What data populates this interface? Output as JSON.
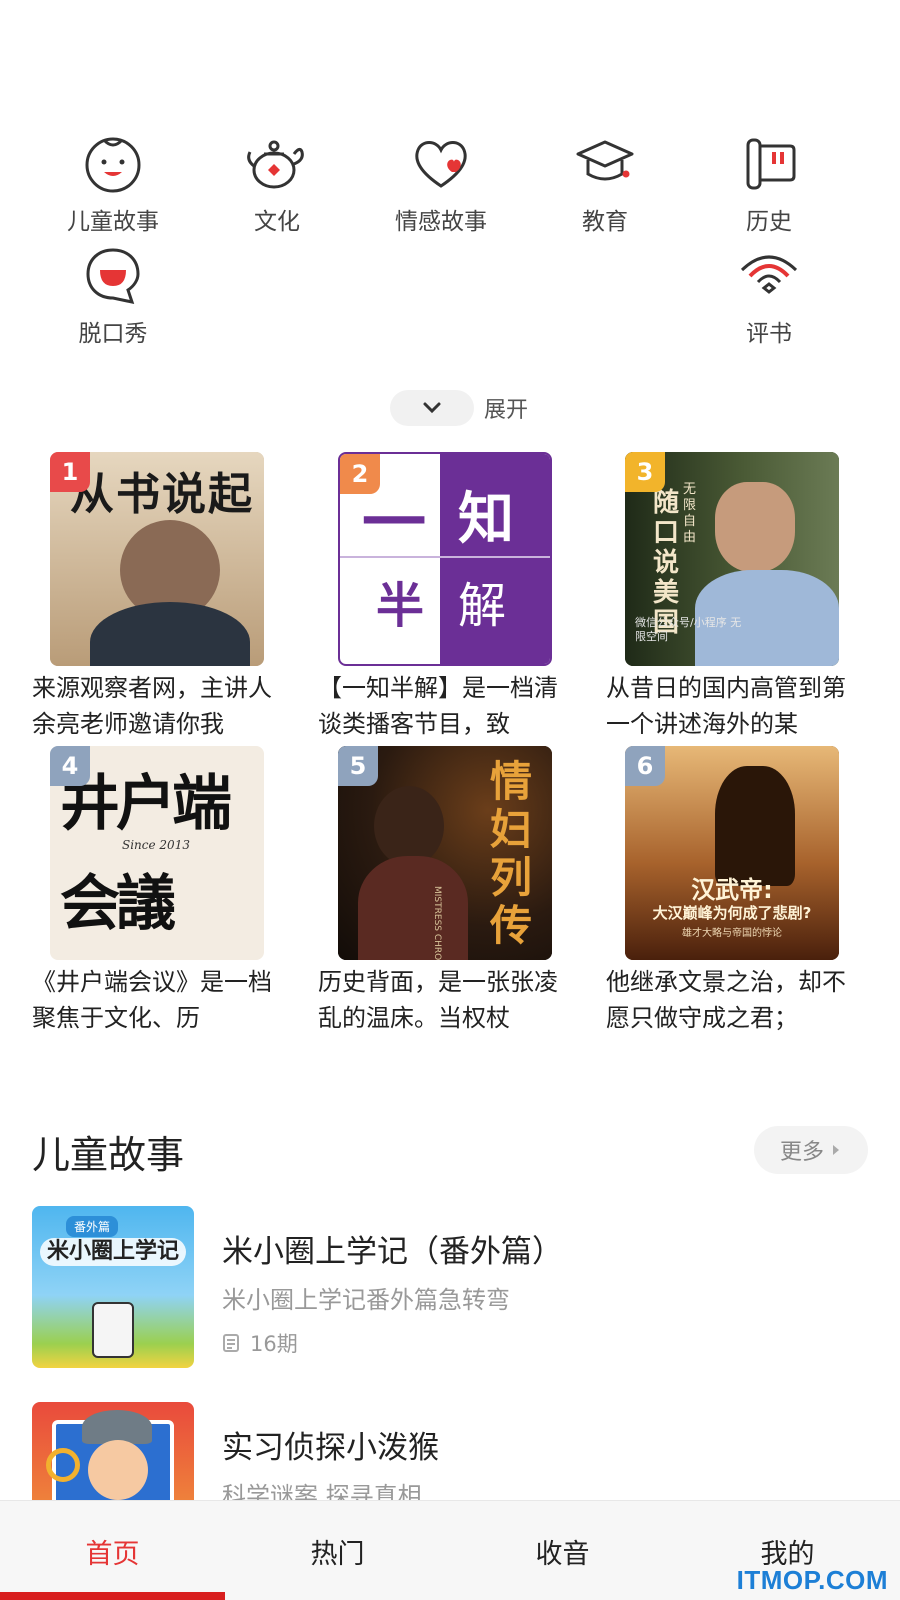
{
  "categories": [
    {
      "label": "儿童故事",
      "icon": "child-face-icon"
    },
    {
      "label": "文化",
      "icon": "teapot-icon"
    },
    {
      "label": "情感故事",
      "icon": "heart-icon"
    },
    {
      "label": "教育",
      "icon": "graduation-cap-icon"
    },
    {
      "label": "历史",
      "icon": "scroll-icon"
    },
    {
      "label": "脱口秀",
      "icon": "chat-bubble-icon"
    },
    {
      "label": "评书",
      "icon": "fan-icon"
    }
  ],
  "expand_label": "展开",
  "ranking": [
    {
      "rank": "1",
      "cover_text": "从书说起",
      "desc": "来源观察者网，主讲人余亮老师邀请你我"
    },
    {
      "rank": "2",
      "cover_text": [
        "一",
        "知",
        "半",
        "解"
      ],
      "desc": "【一知半解】是一档清谈类播客节目，致"
    },
    {
      "rank": "3",
      "cover_text": "随口说美国",
      "cover_sub": "无限自由",
      "cover_foot": "微信公众号/小程序 无限空间",
      "desc": "从昔日的国内高管到第一个讲述海外的某"
    },
    {
      "rank": "4",
      "cover_text": "井户端会議",
      "cover_sub": "Since 2013",
      "desc": "《井户端会议》是一档聚焦于文化、历"
    },
    {
      "rank": "5",
      "cover_text": "情妇列传",
      "cover_sub": "MISTRESS CHRONICLE",
      "desc": "历史背面，是一张张凌乱的温床。当权杖"
    },
    {
      "rank": "6",
      "cover_text": "汉武帝:",
      "cover_sub": "大汉巅峰为何成了悲剧?",
      "cover_foot": "雄才大略与帝国的悖论",
      "desc": "他继承文景之治，却不愿只做守成之君；"
    }
  ],
  "section": {
    "title": "儿童故事",
    "more_label": "更多",
    "items": [
      {
        "title": "米小圈上学记（番外篇）",
        "subtitle": "米小圈上学记番外篇急转弯",
        "count": "16期",
        "cover_text": "米小圈上学记",
        "cover_tag": "番外篇"
      },
      {
        "title": "实习侦探小泼猴",
        "subtitle": "科学谜案 探寻真相",
        "count": "",
        "cover_text": ""
      }
    ]
  },
  "nav": [
    {
      "label": "首页",
      "active": true
    },
    {
      "label": "热门",
      "active": false
    },
    {
      "label": "收音",
      "active": false
    },
    {
      "label": "我的",
      "active": false
    }
  ],
  "watermark": "ITMOP.COM",
  "colors": {
    "accent": "#e53535",
    "badge_top": "#e84a4a",
    "badge_second": "#f08a4b",
    "badge_third": "#f2b42b",
    "badge_rest": "#8fa3bd"
  }
}
